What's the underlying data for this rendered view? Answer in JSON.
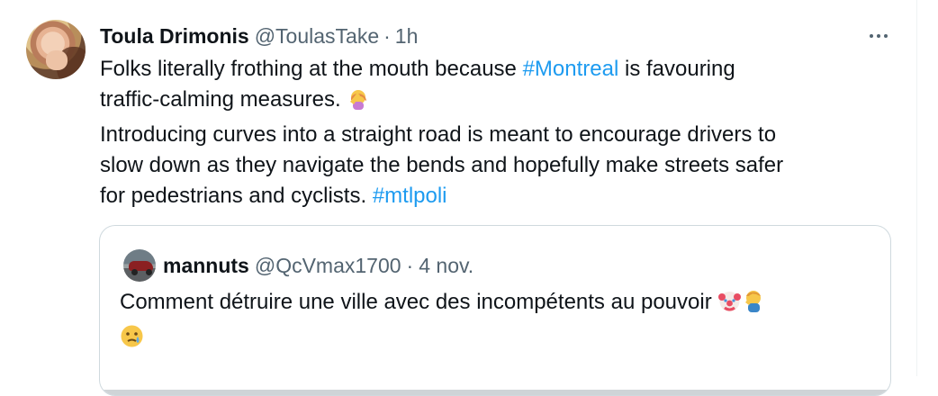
{
  "tweet": {
    "display_name": "Toula Drimonis",
    "handle": "@ToulasTake",
    "separator": "·",
    "time": "1h",
    "text_lines": [
      [
        {
          "kind": "text",
          "value": "Folks literally frothing at the mouth because "
        },
        {
          "kind": "hashtag",
          "value": "#Montreal"
        },
        {
          "kind": "text",
          "value": " is favouring"
        }
      ],
      [
        {
          "kind": "text",
          "value": "traffic-calming measures. "
        },
        {
          "kind": "emoji",
          "value": "person-facepalming"
        }
      ],
      [
        {
          "kind": "text",
          "value": "Introducing curves into a straight road is meant to encourage drivers to"
        }
      ],
      [
        {
          "kind": "text",
          "value": "slow down as they navigate the bends and hopefully make streets safer"
        }
      ],
      [
        {
          "kind": "text",
          "value": "for pedestrians and cyclists. "
        },
        {
          "kind": "hashtag",
          "value": "#mtlpoli"
        }
      ]
    ]
  },
  "quote": {
    "display_name": "mannuts",
    "handle": "@QcVmax1700",
    "separator": "·",
    "time": "4 nov.",
    "text_lines": [
      [
        {
          "kind": "text",
          "value": "Comment détruire une ville avec des incompétents au pouvoir "
        },
        {
          "kind": "emoji",
          "value": "clown-face"
        },
        {
          "kind": "emoji",
          "value": "man-facepalming"
        }
      ],
      [
        {
          "kind": "emoji",
          "value": "crying-face"
        }
      ]
    ]
  },
  "colors": {
    "text": "#0f1419",
    "secondary": "#536471",
    "link": "#1d9bf0",
    "border": "#cfd9de"
  },
  "icons": [
    "more-icon",
    "avatar-photo",
    "quote-avatar-photo"
  ]
}
